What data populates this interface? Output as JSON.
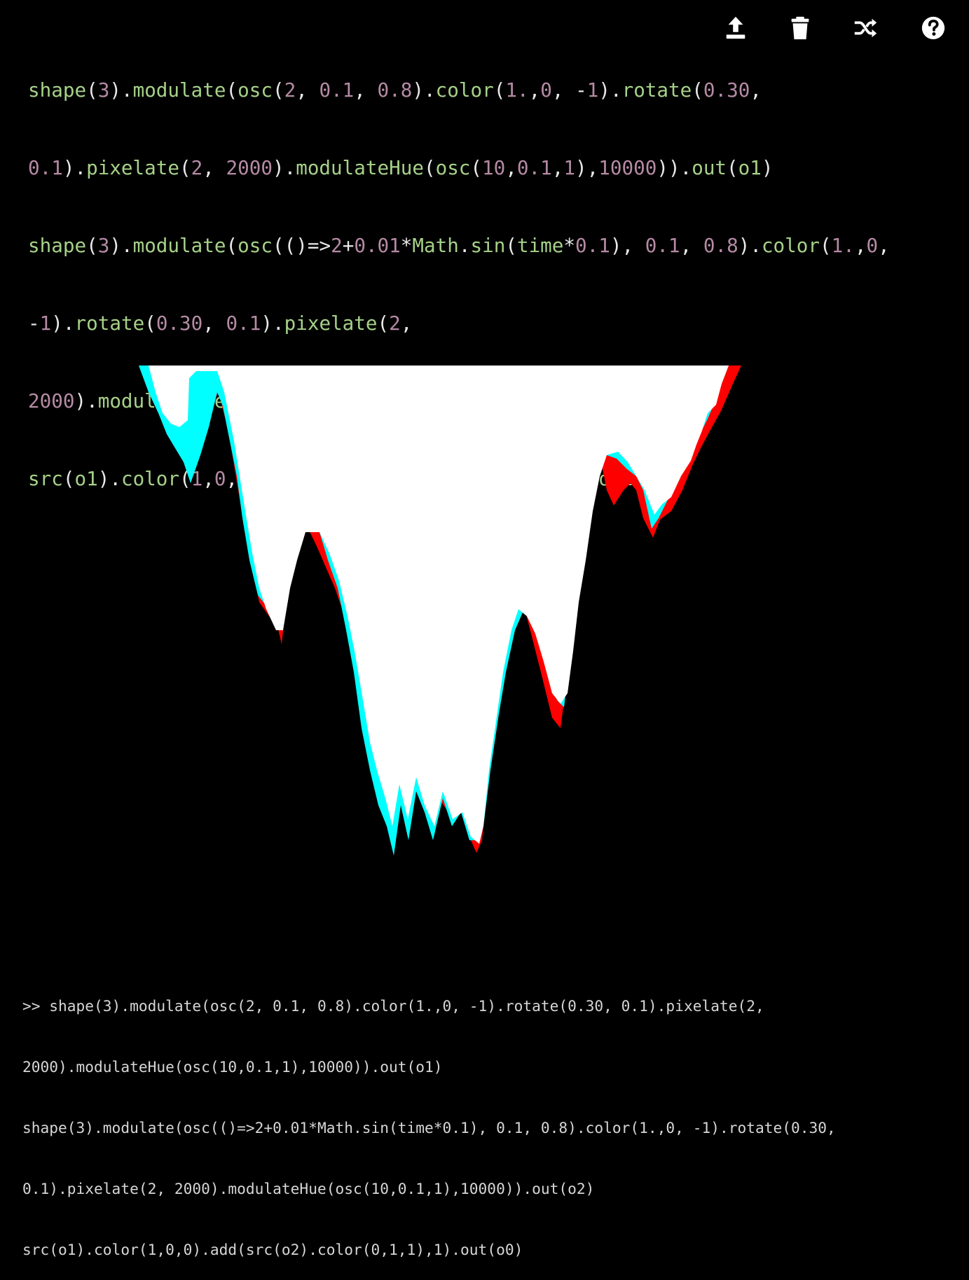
{
  "toolbar": {
    "buttons": [
      {
        "name": "upload-button",
        "icon": "upload-icon"
      },
      {
        "name": "clear-button",
        "icon": "trash-icon"
      },
      {
        "name": "shuffle-button",
        "icon": "shuffle-icon"
      },
      {
        "name": "help-button",
        "icon": "help-icon"
      }
    ]
  },
  "editor": {
    "lines": [
      "shape(3).modulate(osc(2, 0.1, 0.8).color(1.,0, -1).rotate(0.30,",
      "0.1).pixelate(2, 2000).modulateHue(osc(10,0.1,1),10000)).out(o1)",
      "shape(3).modulate(osc(()=>2+0.01*Math.sin(time*0.1), 0.1, 0.8).color(1.,0,",
      "-1).rotate(0.30, 0.1).pixelate(2,",
      "2000).modulateHue(osc(10,0.1,1),10000)).out(o2)",
      "src(o1).color(1,0,0).add(src(o2).color(0,1,1),1).out(o0)"
    ]
  },
  "console": {
    "lines": [
      ">> shape(3).modulate(osc(2, 0.1, 0.8).color(1.,0, -1).rotate(0.30, 0.1).pixelate(2,",
      "2000).modulateHue(osc(10,0.1,1),10000)).out(o1)",
      "shape(3).modulate(osc(()=>2+0.01*Math.sin(time*0.1), 0.1, 0.8).color(1.,0, -1).rotate(0.30,",
      "0.1).pixelate(2, 2000).modulateHue(osc(10,0.1,1),10000)).out(o2)",
      "src(o1).color(1,0,0).add(src(o2).color(0,1,1),1).out(o0)"
    ]
  },
  "colors": {
    "background": "#000000",
    "code_function": "#a6d189",
    "code_number": "#b58aa5",
    "code_punct": "#e8e8e8",
    "console_text": "#d6d6d6",
    "shape_white": "#ffffff",
    "shape_red": "#ff0000",
    "shape_cyan": "#00ffff"
  }
}
